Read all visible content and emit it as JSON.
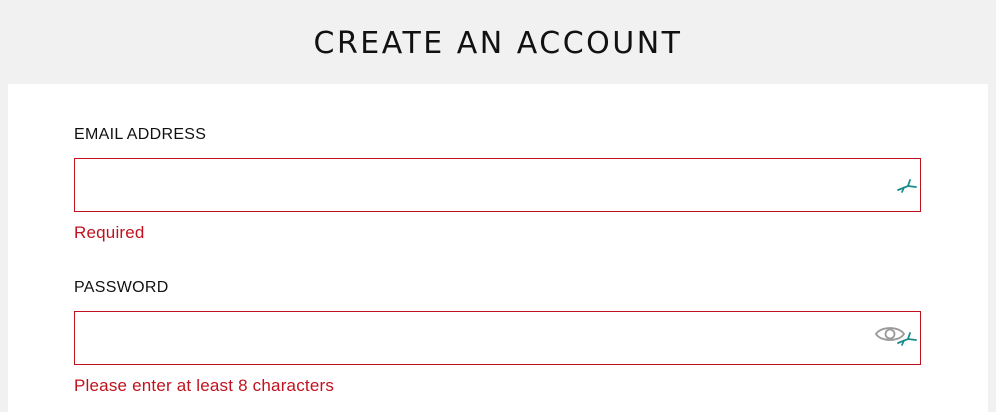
{
  "header": {
    "title": "CREATE AN ACCOUNT"
  },
  "form": {
    "email": {
      "label": "EMAIL ADDRESS",
      "value": "",
      "placeholder": "",
      "error": "Required"
    },
    "password": {
      "label": "PASSWORD",
      "value": "",
      "placeholder": "",
      "error": "Please enter at least 8 characters"
    }
  },
  "colors": {
    "error": "#c0121e",
    "background": "#f1f1f1",
    "card": "#ffffff",
    "autofill_icon": "#1a8a8a",
    "eye_icon": "#9a9a9a"
  },
  "icons": {
    "email_field": "autofill-icon",
    "password_field": [
      "show-password-eye-icon",
      "autofill-icon"
    ]
  }
}
